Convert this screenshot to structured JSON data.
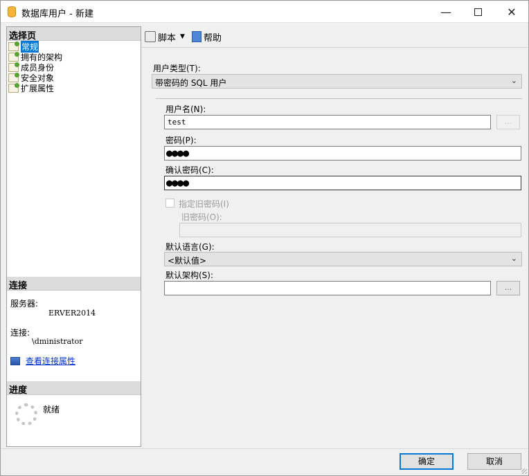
{
  "window": {
    "title": "数据库用户 - 新建"
  },
  "left_pane": {
    "select_page_header": "选择页",
    "pages": [
      {
        "label": "常规",
        "selected": true
      },
      {
        "label": "拥有的架构",
        "selected": false
      },
      {
        "label": "成员身份",
        "selected": false
      },
      {
        "label": "安全对象",
        "selected": false
      },
      {
        "label": "扩展属性",
        "selected": false
      }
    ],
    "connection_header": "连接",
    "server_label": "服务器:",
    "server_value": "ERVER2014",
    "connection_label": "连接:",
    "connection_value": "\\dministrator",
    "view_connection_properties": "查看连接属性",
    "progress_header": "进度",
    "progress_status": "就绪"
  },
  "toolbar": {
    "script_label": "脚本",
    "help_label": "帮助"
  },
  "form": {
    "user_type_label": "用户类型(T):",
    "user_type_value": "带密码的 SQL 用户",
    "user_name_label": "用户名(N):",
    "user_name_value": "test",
    "browse_label": "...",
    "password_label": "密码(P):",
    "password_value": "●●●●",
    "confirm_password_label": "确认密码(C):",
    "confirm_password_value": "●●●●",
    "specify_old_password_label": "指定旧密码(I)",
    "old_password_label": "旧密码(O):",
    "old_password_value": "",
    "default_language_label": "默认语言(G):",
    "default_language_value": "<默认值>",
    "default_schema_label": "默认架构(S):",
    "default_schema_value": ""
  },
  "buttons": {
    "ok": "确定",
    "cancel": "取消"
  }
}
